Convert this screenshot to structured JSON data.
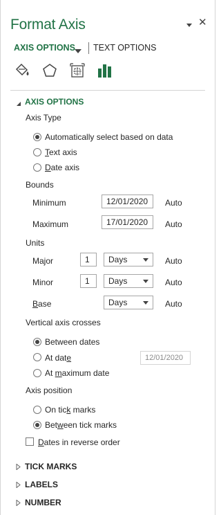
{
  "pane": {
    "title": "Format Axis",
    "dropdown_icon": "triangle-down-icon",
    "close_glyph": "✕"
  },
  "tabs": {
    "axis_options": "AXIS OPTIONS",
    "text_options": "TEXT OPTIONS"
  },
  "icons": [
    "fill-line-icon",
    "effects-icon",
    "size-properties-icon",
    "axis-options-icon"
  ],
  "colors": {
    "accent": "#217346",
    "text": "#262626",
    "border": "#a6a6a6"
  },
  "section": {
    "title": "AXIS OPTIONS",
    "axis_type": {
      "label": "Axis Type",
      "options": [
        {
          "label": "Automatically select based on data",
          "selected": true
        },
        {
          "label_pre": "",
          "label_ul": "T",
          "label_post": "ext axis",
          "selected": false
        },
        {
          "label_pre": "",
          "label_ul": "D",
          "label_post": "ate axis",
          "selected": false
        }
      ]
    },
    "bounds": {
      "label": "Bounds",
      "minimum_label": "Minimum",
      "minimum_value": "12/01/2020",
      "minimum_status": "Auto",
      "maximum_label": "Maximum",
      "maximum_value": "17/01/2020",
      "maximum_status": "Auto"
    },
    "units": {
      "label": "Units",
      "major_label": "Major",
      "major_value": "1",
      "major_unit": "Days",
      "major_status": "Auto",
      "minor_label": "Minor",
      "minor_value": "1",
      "minor_unit": "Days",
      "minor_status": "Auto",
      "base_label_ul": "B",
      "base_label_rest": "ase",
      "base_unit": "Days",
      "base_status": "Auto"
    },
    "vertical_axis_crosses": {
      "label": "Vertical axis crosses",
      "between_dates": "Between dates",
      "at_date_pre": "At dat",
      "at_date_ul": "e",
      "at_date_value": "12/01/2020",
      "at_max_pre": "At ",
      "at_max_ul": "m",
      "at_max_post": "aximum date",
      "selected": "between_dates"
    },
    "axis_position": {
      "label": "Axis position",
      "on_tick_pre": "On tic",
      "on_tick_ul": "k",
      "on_tick_post": " marks",
      "between_tick_pre": "Bet",
      "between_tick_ul": "w",
      "between_tick_post": "een tick marks",
      "selected": "between_tick_marks"
    },
    "reverse_order": {
      "label_ul": "D",
      "label_rest": "ates in reverse order",
      "checked": false
    }
  },
  "collapsed_sections": [
    "TICK MARKS",
    "LABELS",
    "NUMBER"
  ]
}
